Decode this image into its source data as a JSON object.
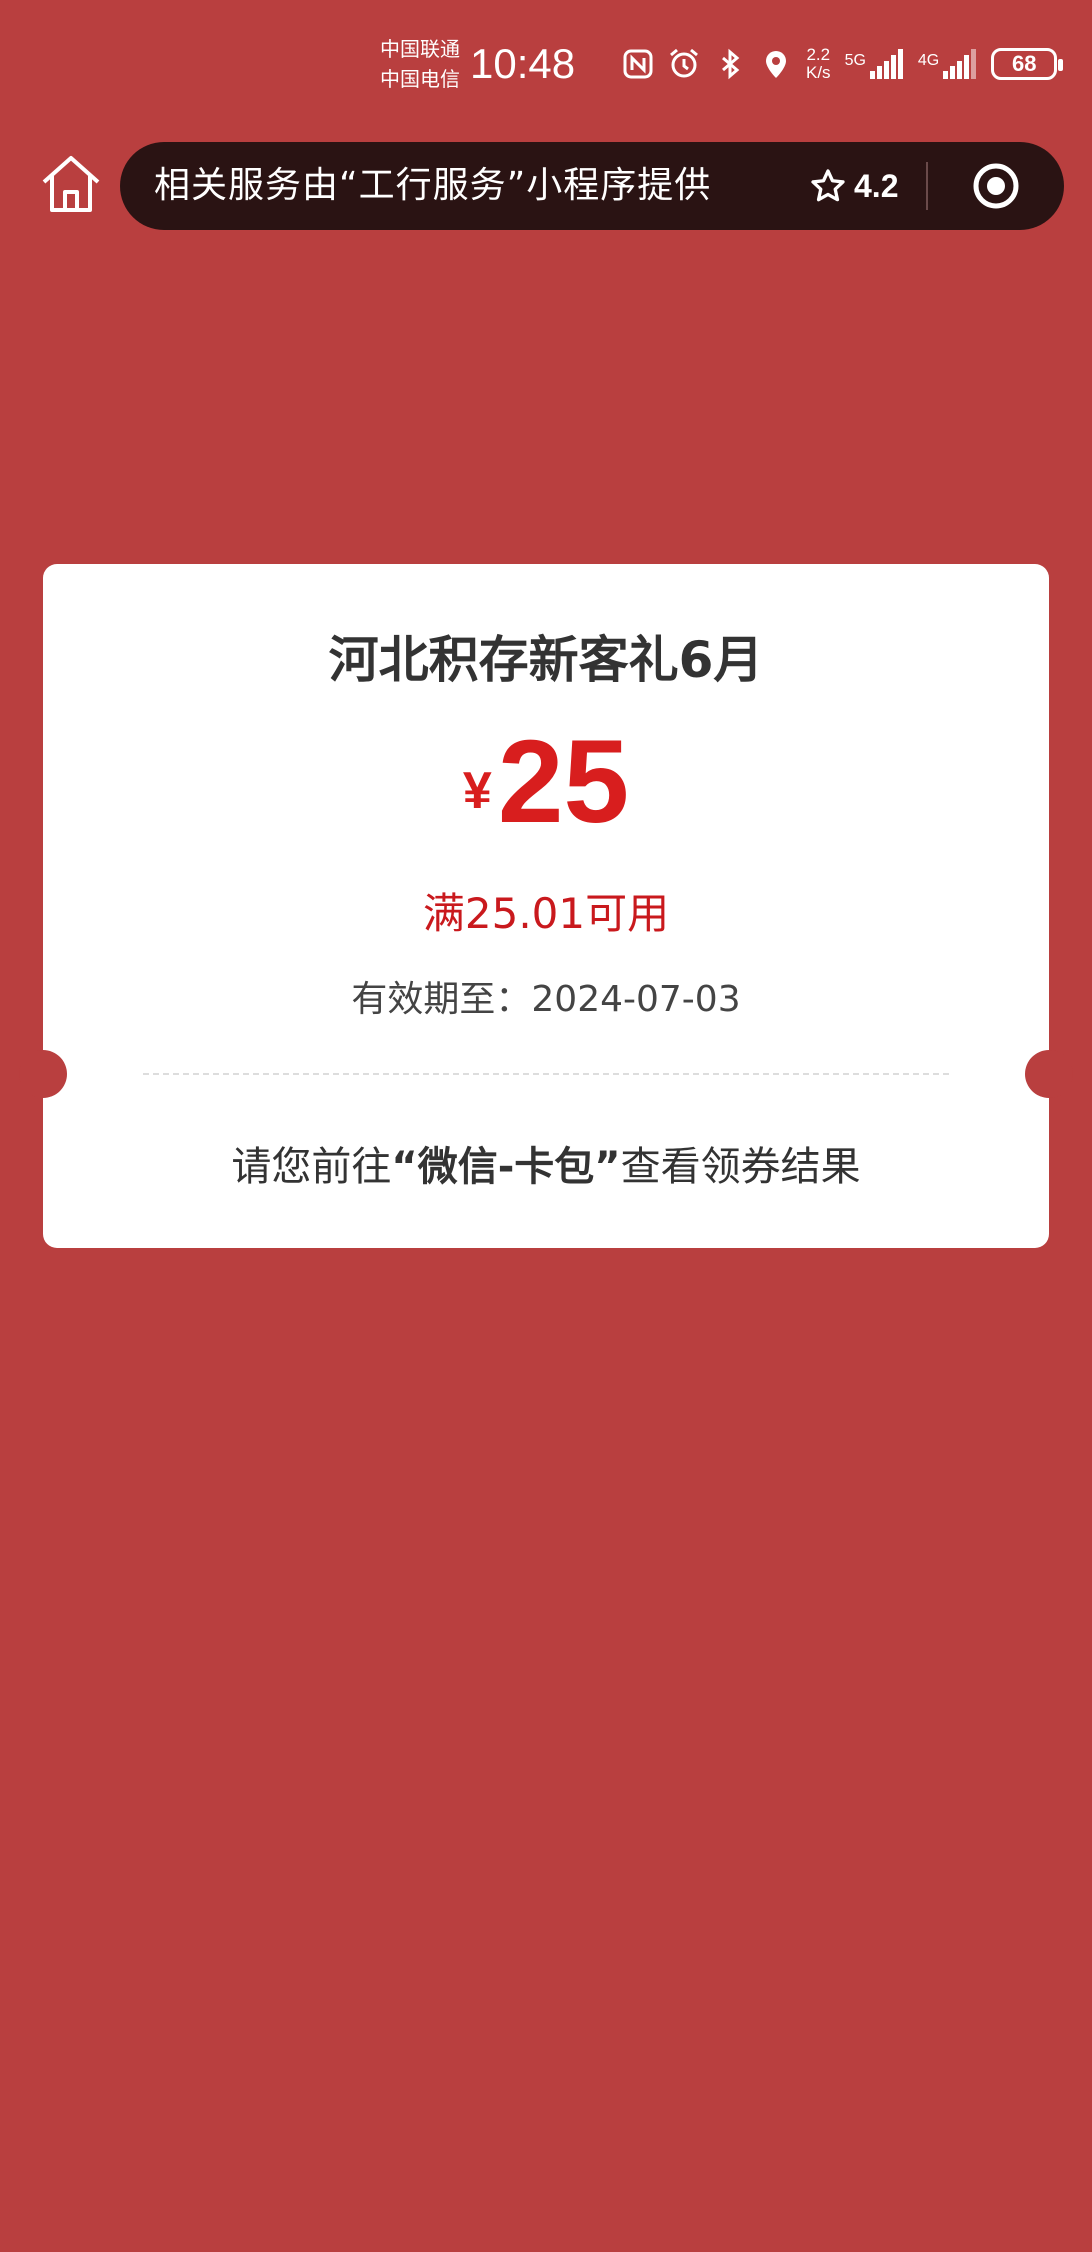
{
  "status_bar": {
    "carrier_1": "中国联通",
    "carrier_2": "中国电信",
    "time": "10:48",
    "net_speed_value": "2.2",
    "net_speed_unit": "K/s",
    "network_1": "5G",
    "network_2": "4G",
    "battery": "68",
    "icons": [
      "nfc-icon",
      "alarm-icon",
      "bluetooth-icon",
      "location-icon",
      "signal-icon",
      "signal-icon",
      "battery-icon"
    ]
  },
  "nav": {
    "home_icon": "home-icon",
    "notice": "相关服务由“工行服务”小程序提供",
    "rating": "4.2",
    "star_icon": "star-icon",
    "more_icon": "target-icon"
  },
  "coupon": {
    "title": "河北积存新客礼6月",
    "currency": "¥",
    "amount": "25",
    "condition": "满25.01可用",
    "validity": "有效期至：2024-07-03",
    "hint_prefix": "请您前往",
    "hint_highlight": "“微信-卡包”",
    "hint_suffix": "查看领券结果"
  },
  "colors": {
    "background": "#b93f3f",
    "accent_red": "#d81e1e",
    "capsule": "#2a1313"
  }
}
